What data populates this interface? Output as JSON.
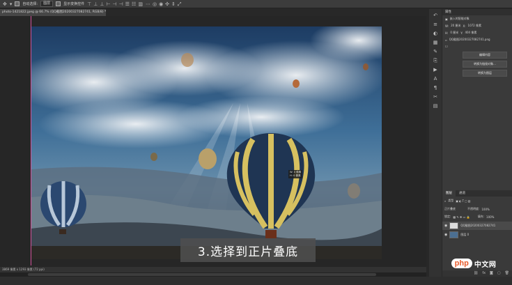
{
  "options_bar": {
    "move_icon": "move-icon",
    "auto_select_label": "自动选择:",
    "auto_select_target": "图层",
    "transform_label": "显示变换控件"
  },
  "document_tab": {
    "title": "photo-1421822.jpeg @ 66.7% (QQ截图20200327082741, RGB/8) *"
  },
  "canvas": {
    "subtitle": "3.选择到正片叠底",
    "readout_w": "W: 0 像素",
    "readout_h": "H: 0 像素"
  },
  "status_bar": {
    "text": "3869 像素 x 1293 像素 (72 ppi)"
  },
  "properties_panel": {
    "title": "属性",
    "subtitle": "嵌入的智能对象",
    "w_label": "W:",
    "w_value": "20 厘米",
    "h_label": "H:",
    "h_value": "0 厘米",
    "x_label": "X:",
    "x_value": "1072 像素",
    "y_label": "Y:",
    "y_value": "404 像素",
    "file_name": "QQ截图20200327082741.png",
    "btn_edit": "编辑内容",
    "btn_convert": "转换为链接对象...",
    "btn_layers": "转换为图层"
  },
  "layers_panel": {
    "tab_layers": "图层",
    "tab_channels": "通道",
    "kind_label": "类型",
    "blend_mode": "正片叠底",
    "opacity_label": "不透明度:",
    "opacity_value": "100%",
    "lock_label": "锁定:",
    "fill_label": "填充:",
    "fill_value": "100%",
    "layers": [
      {
        "name": "QQ截图20200327082741"
      },
      {
        "name": "图层 0"
      }
    ]
  },
  "watermark": {
    "badge": "php",
    "rest": "中文网"
  },
  "colors": {
    "guide": "#d2529a",
    "panel": "#3a3a3a",
    "bg": "#282828"
  }
}
